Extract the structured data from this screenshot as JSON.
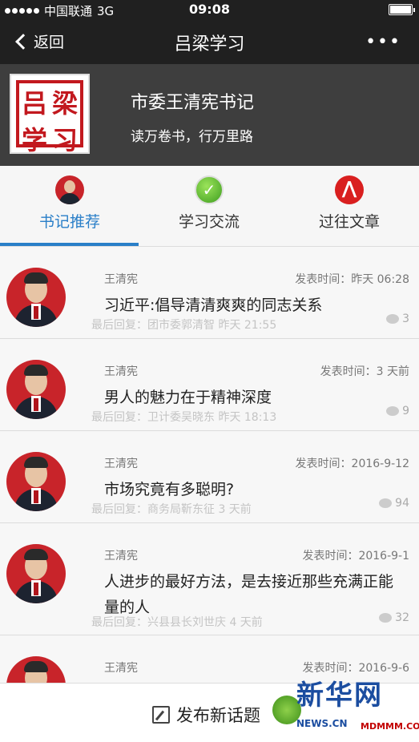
{
  "status": {
    "carrier": "中国联通",
    "network": "3G",
    "time": "09:08"
  },
  "nav": {
    "back_label": "返回",
    "title": "吕梁学习",
    "more_label": "•••"
  },
  "header": {
    "seal_chars": [
      "吕",
      "梁",
      "学",
      "习"
    ],
    "title": "市委王清宪书记",
    "subtitle": "读万卷书，行万里路"
  },
  "tabs": [
    {
      "label": "书记推荐",
      "icon": "avatar-icon",
      "active": true
    },
    {
      "label": "学习交流",
      "icon": "green-check-icon",
      "active": false
    },
    {
      "label": "过往文章",
      "icon": "red-figure-icon",
      "active": false
    }
  ],
  "articles": [
    {
      "author": "王清宪",
      "date": "发表时间：昨天 06:28",
      "title": "习近平:倡导清清爽爽的同志关系",
      "last_reply": "最后回复：团市委郭清智 昨天 21:55",
      "comments": "3"
    },
    {
      "author": "王清宪",
      "date": "发表时间：3 天前",
      "title": "男人的魅力在于精神深度",
      "last_reply": "最后回复：卫计委吴晓东 昨天 18:13",
      "comments": "9"
    },
    {
      "author": "王清宪",
      "date": "发表时间：2016-9-12",
      "title": "市场究竟有多聪明?",
      "last_reply": "最后回复：商务局靳东征 3 天前",
      "comments": "94"
    },
    {
      "author": "王清宪",
      "date": "发表时间：2016-9-1",
      "title": "人进步的最好方法，是去接近那些充满正能量的人",
      "last_reply": "最后回复：兴县县长刘世庆 4 天前",
      "comments": "32"
    },
    {
      "author": "王清宪",
      "date": "发表时间：2016-9-6",
      "title": "",
      "last_reply": "",
      "comments": ""
    }
  ],
  "bottom": {
    "publish_label": "发布新话题"
  },
  "watermark": {
    "big": "新华网",
    "small": "NEWS.CN",
    "red": "MDMMM.COM"
  },
  "colors": {
    "accent": "#2a7fc8",
    "nav_bg": "#202020",
    "header_bg": "#3e3e3e",
    "seal_red": "#c2181e"
  }
}
